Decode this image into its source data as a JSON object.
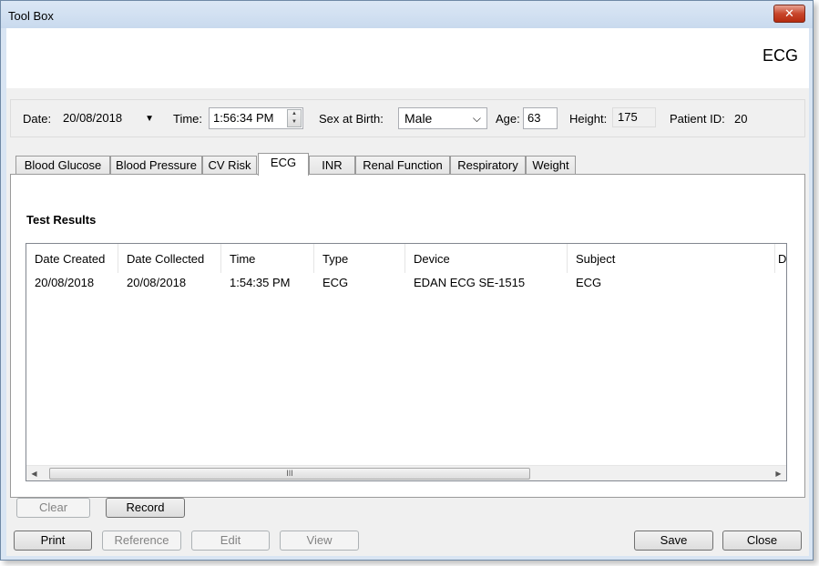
{
  "window": {
    "title": "Tool Box",
    "close_glyph": "✕"
  },
  "header": {
    "title": "ECG"
  },
  "patient": {
    "date_label": "Date:",
    "date_value": "20/08/2018",
    "time_label": "Time:",
    "time_value": "1:56:34 PM",
    "sex_label": "Sex at Birth:",
    "sex_value": "Male",
    "age_label": "Age:",
    "age_value": "63",
    "height_label": "Height:",
    "height_value": "175",
    "patient_id_label": "Patient ID:",
    "patient_id_value": "20"
  },
  "tabs": [
    {
      "label": "Blood Glucose"
    },
    {
      "label": "Blood Pressure"
    },
    {
      "label": "CV Risk"
    },
    {
      "label": "ECG",
      "active": true
    },
    {
      "label": "INR"
    },
    {
      "label": "Renal Function"
    },
    {
      "label": "Respiratory"
    },
    {
      "label": "Weight"
    }
  ],
  "results": {
    "title": "Test Results",
    "columns": [
      "Date Created",
      "Date Collected",
      "Time",
      "Type",
      "Device",
      "Subject",
      "D"
    ],
    "rows": [
      [
        "20/08/2018",
        "20/08/2018",
        "1:54:35 PM",
        "ECG",
        "EDAN ECG SE-1515",
        "ECG"
      ]
    ],
    "scroll_thumb_glyph": "III"
  },
  "panel_buttons": {
    "clear": "Clear",
    "record": "Record"
  },
  "footer_buttons": {
    "print": "Print",
    "reference": "Reference",
    "edit": "Edit",
    "view": "View",
    "save": "Save",
    "close": "Close"
  },
  "icons": {
    "close": "close-icon",
    "dropdown": "chevron-down-icon",
    "spin": "spin-icon",
    "scroll_left": "scroll-left-icon",
    "scroll_right": "scroll-right-icon"
  }
}
